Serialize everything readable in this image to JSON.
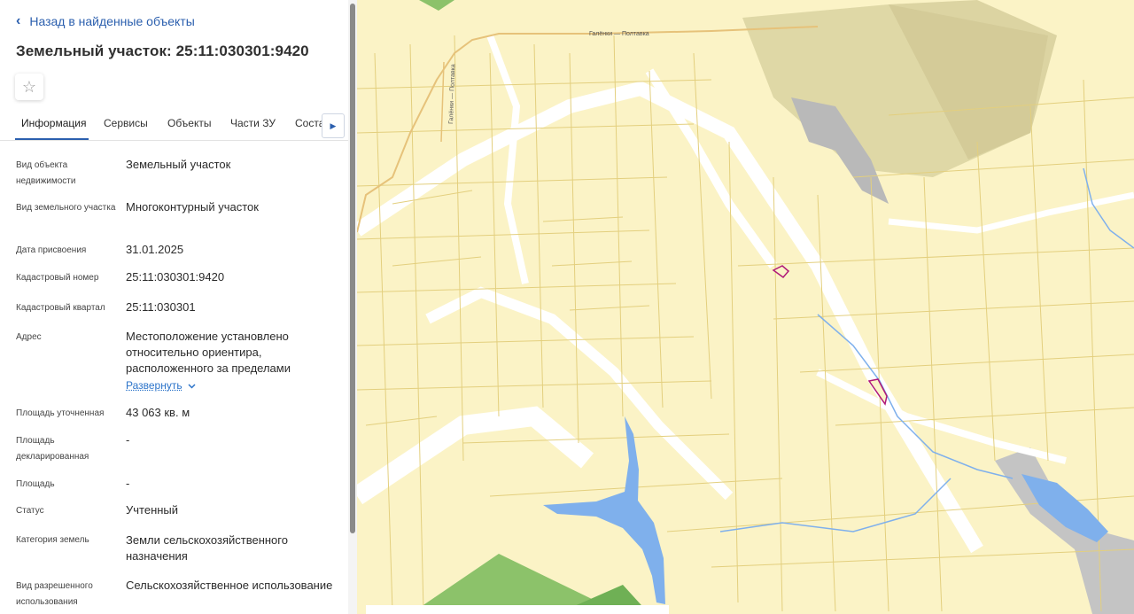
{
  "panel": {
    "back_label": "Назад в найденные объекты",
    "title": "Земельный участок: 25:11:030301:9420",
    "tabs": [
      "Информация",
      "Сервисы",
      "Объекты",
      "Части ЗУ",
      "Соста"
    ],
    "active_tab": "Информация",
    "expand_label": "Развернуть",
    "fields": [
      {
        "label": "Вид объекта недвижимости",
        "value": "Земельный участок"
      },
      {
        "label": "Вид земельного участка",
        "value": "Многоконтурный участок"
      },
      {
        "label": "Дата присвоения",
        "value": "31.01.2025"
      },
      {
        "label": "Кадастровый номер",
        "value": "25:11:030301:9420"
      },
      {
        "label": "Кадастровый квартал",
        "value": "25:11:030301"
      },
      {
        "label": "Адрес",
        "value": "Местоположение установлено относительно ориентира, расположенного за пределами"
      },
      {
        "label": "Площадь уточненная",
        "value": "43 063 кв. м"
      },
      {
        "label": "Площадь декларированная",
        "value": "-"
      },
      {
        "label": "Площадь",
        "value": "-"
      },
      {
        "label": "Статус",
        "value": "Учтенный"
      },
      {
        "label": "Категория земель",
        "value": "Земли сельскохозяйственного назначения"
      },
      {
        "label": "Вид разрешенного использования",
        "value": "Сельскохозяйственное использование"
      }
    ]
  },
  "map": {
    "road_labels": [
      "Галёнки — Полтавка",
      "Галёнки — Полтавка"
    ],
    "colors": {
      "parcel_fill": "#fbf3c6",
      "parcel_line": "#e3cf7e",
      "water": "#7fb0ec",
      "forest": "#8cc26a",
      "highlight": "#b01878"
    }
  }
}
